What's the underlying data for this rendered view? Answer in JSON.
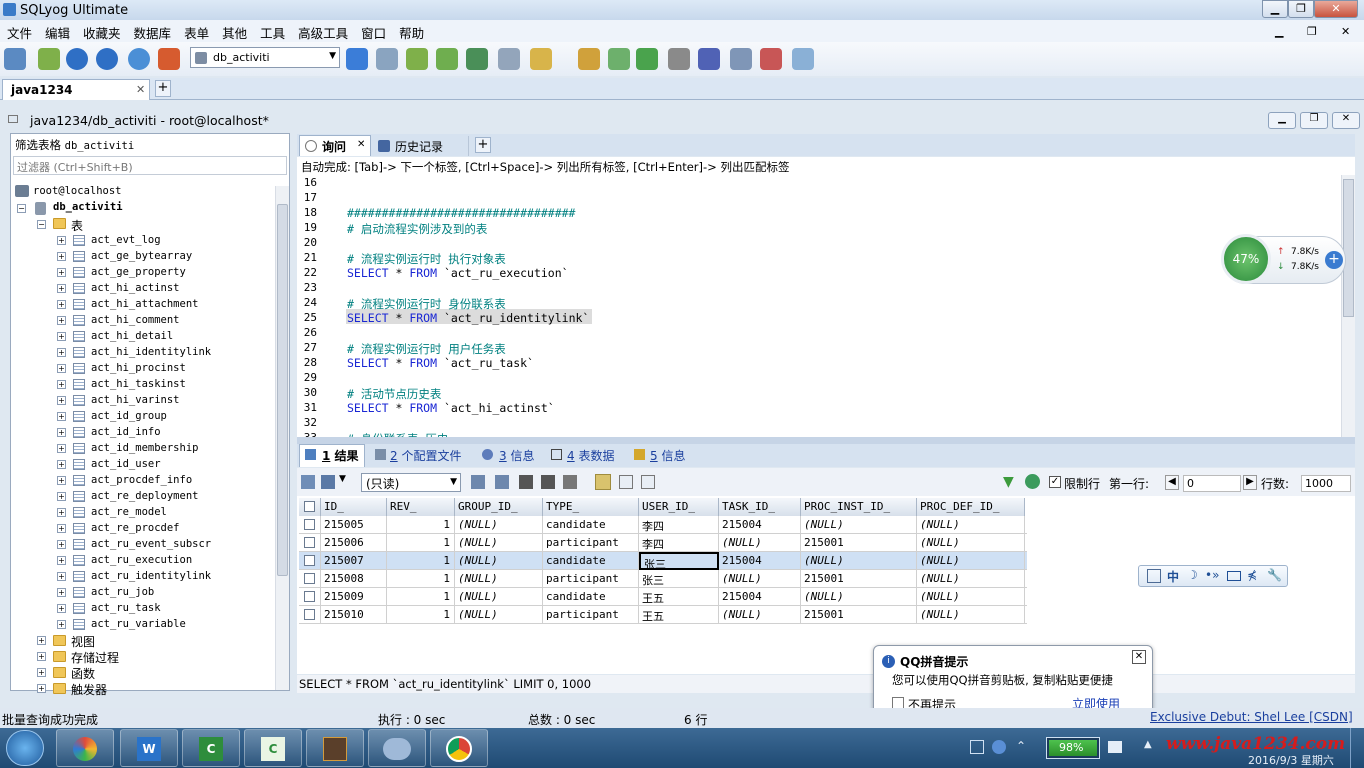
{
  "window": {
    "title": "SQLyog Ultimate",
    "min": "▁",
    "max": "❐",
    "close": "✕"
  },
  "menu": [
    "文件",
    "编辑",
    "收藏夹",
    "数据库",
    "表单",
    "其他",
    "工具",
    "高级工具",
    "窗口",
    "帮助"
  ],
  "toolbar": {
    "db_select": "db_activiti"
  },
  "connection_tab": {
    "label": "java1234",
    "close": "✕",
    "add": "+"
  },
  "connection_title": "java1234/db_activiti - root@localhost*",
  "left": {
    "filter_label": "筛选表格",
    "filter_db": "db_activiti",
    "filter_placeholder": "过滤器 (Ctrl+Shift+B)",
    "root": "root@localhost",
    "db": "db_activiti",
    "tables_folder": "表",
    "tables": [
      "act_evt_log",
      "act_ge_bytearray",
      "act_ge_property",
      "act_hi_actinst",
      "act_hi_attachment",
      "act_hi_comment",
      "act_hi_detail",
      "act_hi_identitylink",
      "act_hi_procinst",
      "act_hi_taskinst",
      "act_hi_varinst",
      "act_id_group",
      "act_id_info",
      "act_id_membership",
      "act_id_user",
      "act_procdef_info",
      "act_re_deployment",
      "act_re_model",
      "act_re_procdef",
      "act_ru_event_subscr",
      "act_ru_execution",
      "act_ru_identitylink",
      "act_ru_job",
      "act_ru_task",
      "act_ru_variable"
    ],
    "folders": [
      "视图",
      "存储过程",
      "函数",
      "触发器"
    ]
  },
  "query_tabs": {
    "query": "询问",
    "history": "历史记录",
    "add": "+"
  },
  "autocomplete_hint": "自动完成: [Tab]-> 下一个标签, [Ctrl+Space]-> 列出所有标签, [Ctrl+Enter]-> 列出匹配标签",
  "editor_lines": [
    {
      "n": "16",
      "t": "",
      "c": ""
    },
    {
      "n": "17",
      "t": "",
      "c": ""
    },
    {
      "n": "18",
      "t": "#################################",
      "c": "cm"
    },
    {
      "n": "19",
      "t": "# 启动流程实例涉及到的表",
      "c": "cm"
    },
    {
      "n": "20",
      "t": "",
      "c": ""
    },
    {
      "n": "21",
      "t": "# 流程实例运行时 执行对象表",
      "c": "cm"
    },
    {
      "n": "22",
      "t": "SELECT * FROM `act_ru_execution`",
      "c": "sql"
    },
    {
      "n": "23",
      "t": "",
      "c": ""
    },
    {
      "n": "24",
      "t": "# 流程实例运行时 身份联系表",
      "c": "cm"
    },
    {
      "n": "25",
      "t": "SELECT * FROM `act_ru_identitylink`",
      "c": "sql"
    },
    {
      "n": "26",
      "t": "",
      "c": ""
    },
    {
      "n": "27",
      "t": "# 流程实例运行时 用户任务表",
      "c": "cm"
    },
    {
      "n": "28",
      "t": "SELECT * FROM `act_ru_task`",
      "c": "sql"
    },
    {
      "n": "29",
      "t": "",
      "c": ""
    },
    {
      "n": "30",
      "t": "# 活动节点历史表",
      "c": "cm"
    },
    {
      "n": "31",
      "t": "SELECT * FROM `act_hi_actinst`",
      "c": "sql"
    },
    {
      "n": "32",
      "t": "",
      "c": ""
    },
    {
      "n": "33",
      "t": "# 身份联系表 历史",
      "c": "cm"
    }
  ],
  "result_tabs": [
    {
      "num": "1",
      "label": "结果"
    },
    {
      "num": "2",
      "label": "个配置文件"
    },
    {
      "num": "3",
      "label": "信息"
    },
    {
      "num": "4",
      "label": "表数据"
    },
    {
      "num": "5",
      "label": "信息"
    }
  ],
  "result_toolbar": {
    "mode": "(只读)",
    "limit_rows": "限制行",
    "first_row_label": "第一行:",
    "first_row": "0",
    "rows_label": "行数:",
    "rows": "1000"
  },
  "grid": {
    "columns": [
      "ID_",
      "REV_",
      "GROUP_ID_",
      "TYPE_",
      "USER_ID_",
      "TASK_ID_",
      "PROC_INST_ID_",
      "PROC_DEF_ID_"
    ],
    "rows": [
      [
        "215005",
        "1",
        "(NULL)",
        "candidate",
        "李四",
        "215004",
        "(NULL)",
        "(NULL)"
      ],
      [
        "215006",
        "1",
        "(NULL)",
        "participant",
        "李四",
        "(NULL)",
        "215001",
        "(NULL)"
      ],
      [
        "215007",
        "1",
        "(NULL)",
        "candidate",
        "张三",
        "215004",
        "(NULL)",
        "(NULL)"
      ],
      [
        "215008",
        "1",
        "(NULL)",
        "participant",
        "张三",
        "(NULL)",
        "215001",
        "(NULL)"
      ],
      [
        "215009",
        "1",
        "(NULL)",
        "candidate",
        "王五",
        "215004",
        "(NULL)",
        "(NULL)"
      ],
      [
        "215010",
        "1",
        "(NULL)",
        "participant",
        "王五",
        "(NULL)",
        "215001",
        "(NULL)"
      ]
    ]
  },
  "query_status": "SELECT * FROM `act_ru_identitylink` LIMIT 0, 1000",
  "status": {
    "msg": "批量查询成功完成",
    "exec": "执行 : 0 sec",
    "total": "总数 : 0 sec",
    "rows": "6 行",
    "credit": "Exclusive Debut: Shel Lee [CSDN]"
  },
  "qq_popup": {
    "title": "QQ拼音提示",
    "body": "您可以使用QQ拼音剪贴板, 复制粘贴更便捷",
    "checkbox": "不再提示",
    "link": "立即使用",
    "close": "✕"
  },
  "speed_widget": {
    "percent": "47%",
    "up": "7.8K/s",
    "down": "7.8K/s"
  },
  "ime_bar": "中",
  "taskbar": {
    "battery": "98%",
    "watermark": "www.java1234.com",
    "date": "2016/9/3 星期六"
  },
  "colors": {
    "accent": "#1a27d4",
    "comment": "#008080",
    "selected_row": "#cfe0f4"
  }
}
